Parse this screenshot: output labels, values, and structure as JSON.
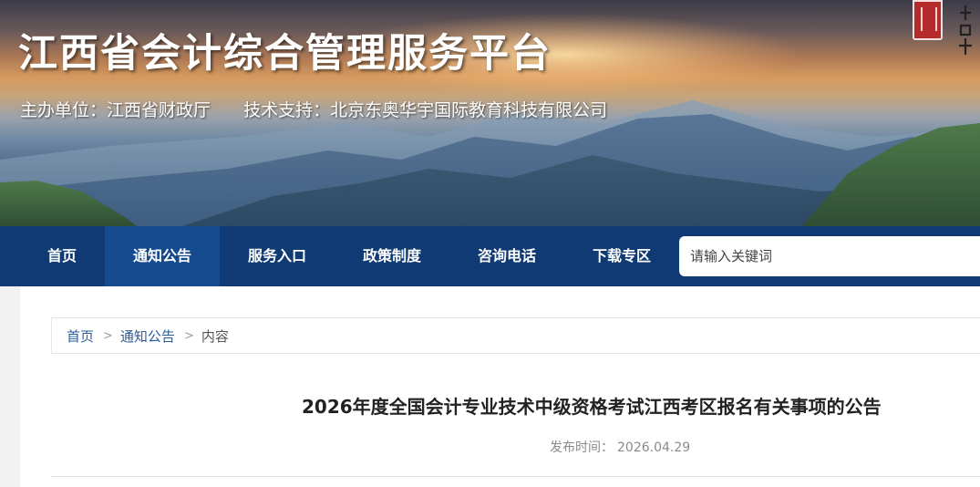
{
  "header": {
    "title": "江西省会计综合管理服务平台",
    "organizer": "主办单位：江西省财政厅",
    "tech_support": "技术支持：北京东奥华宇国际教育科技有限公司"
  },
  "nav": {
    "items": [
      {
        "label": "首页"
      },
      {
        "label": "通知公告"
      },
      {
        "label": "服务入口"
      },
      {
        "label": "政策制度"
      },
      {
        "label": "咨询电话"
      },
      {
        "label": "下载专区"
      }
    ],
    "active_label": "通知公告",
    "search_placeholder": "请输入关键词"
  },
  "breadcrumb": {
    "home": "首页",
    "section": "通知公告",
    "current": "内容",
    "separator": ">"
  },
  "article": {
    "title": "2026年度全国会计专业技术中级资格考试江西考区报名有关事项的公告",
    "date_label": "发布时间：",
    "date": "2026.04.29"
  },
  "colors": {
    "nav_bg": "#0f3a73",
    "nav_active": "#154b8e",
    "link": "#2a5d9a"
  }
}
